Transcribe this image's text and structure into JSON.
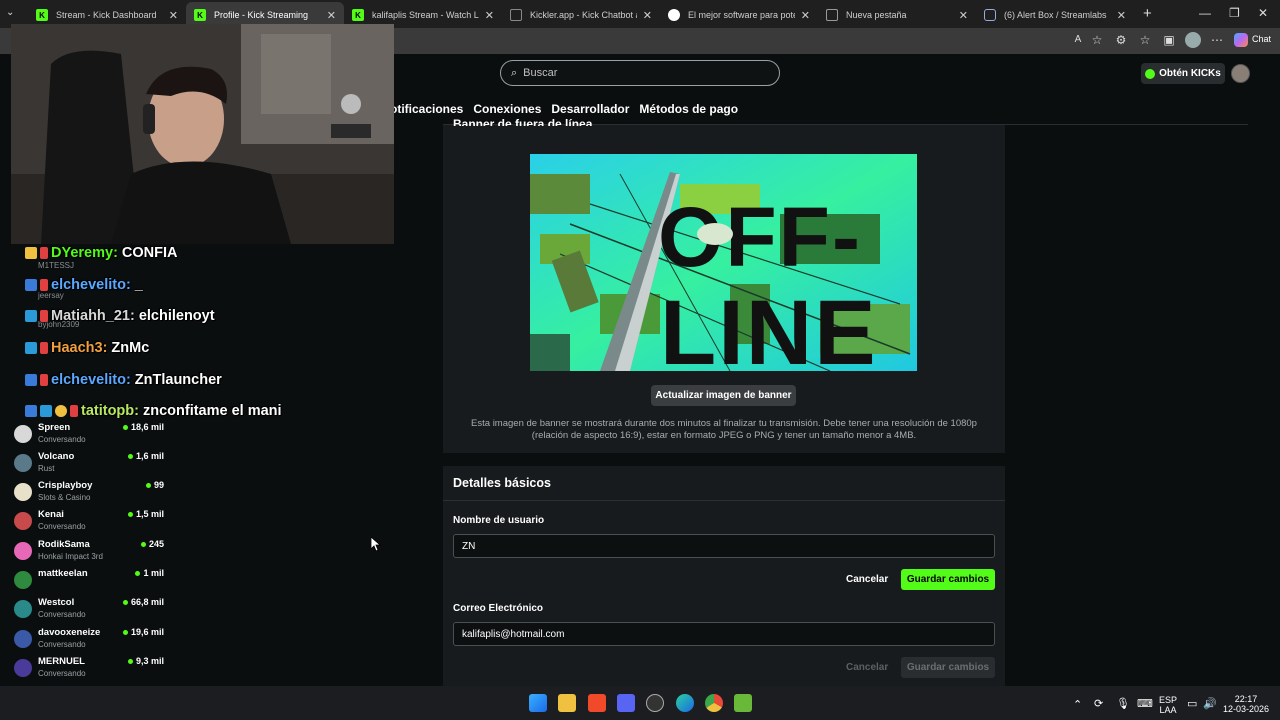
{
  "browser": {
    "tabs": [
      {
        "title": "Stream - Kick Dashboard",
        "active": false
      },
      {
        "title": "Profile - Kick Streaming",
        "active": true
      },
      {
        "title": "kalifaplis Stream - Watch Live on K",
        "active": false
      },
      {
        "title": "Kickler.app - Kick Chatbot and Ov",
        "active": false
      },
      {
        "title": "El mejor software para potenciar t",
        "active": false
      },
      {
        "title": "Nueva pestaña",
        "active": false
      },
      {
        "title": "(6) Alert Box / Streamlabs",
        "active": false
      }
    ],
    "chat_label": "Chat"
  },
  "site": {
    "search_placeholder": "Buscar",
    "get_kicks_label": "Obtén KICKs",
    "settings_nav": [
      "otificaciones",
      "Conexiones",
      "Desarrollador",
      "Métodos de pago"
    ],
    "banner": {
      "heading": "Banner de fuera de línea",
      "image_text_line1": "OFF-",
      "image_text_line2": "LINE",
      "update_button": "Actualizar imagen de banner",
      "description": "Esta imagen de banner se mostrará durante dos minutos al finalizar tu transmisión. Debe tener una resolución de 1080p (relación de aspecto 16:9), estar en formato JPEG o PNG y tener un tamaño menor a 4MB."
    },
    "details": {
      "title": "Detalles básicos",
      "username_label": "Nombre de usuario",
      "username_value": "ZN",
      "email_label": "Correo Electrónico",
      "email_value": "kalifaplis@hotmail.com",
      "cancel_label": "Cancelar",
      "save_label": "Guardar cambios"
    }
  },
  "sidebar": {
    "channels": [
      {
        "name": "Spreen",
        "category": "Conversando",
        "viewers": "18,6 mil",
        "color": "#d8d8d8"
      },
      {
        "name": "Volcano",
        "category": "Rust",
        "viewers": "1,6 mil",
        "color": "#5a7a8a"
      },
      {
        "name": "Crisplayboy",
        "category": "Slots & Casino",
        "viewers": "99",
        "color": "#e8e0c8"
      },
      {
        "name": "Kenai",
        "category": "Conversando",
        "viewers": "1,5 mil",
        "color": "#c84a4a"
      },
      {
        "name": "RodikSama",
        "category": "Honkai Impact 3rd",
        "viewers": "245",
        "color": "#e868b8"
      },
      {
        "name": "mattkeelan",
        "category": "",
        "viewers": "1 mil",
        "color": "#2e8a3e"
      },
      {
        "name": "Westcol",
        "category": "Conversando",
        "viewers": "66,8 mil",
        "color": "#2a8a8a"
      },
      {
        "name": "davooxeneize",
        "category": "Conversando",
        "viewers": "19,6 mil",
        "color": "#3a5aa8"
      },
      {
        "name": "MERNUEL",
        "category": "Conversando",
        "viewers": "9,3 mil",
        "color": "#4a3a9a"
      }
    ]
  },
  "chat_overlay": [
    {
      "user": "DYeremy:",
      "message": "CONFIA",
      "user_color": "#53fc18"
    },
    {
      "user": "elchevelito:",
      "message": "_",
      "user_color": "#5aa8ff"
    },
    {
      "user": "Matiahh_21:",
      "message": "elchilenoyt",
      "user_color": "#d8d8d8"
    },
    {
      "user": "Haach3:",
      "message": "ZnMc",
      "user_color": "#f0a040"
    },
    {
      "user": "elchevelito:",
      "message": "ZnTlauncher",
      "user_color": "#5aa8ff"
    },
    {
      "user": "tatitopb:",
      "message": "znconfitame el mani",
      "user_color": "#b8e860"
    }
  ],
  "chat_faint_names": [
    "M1TESSJ",
    "jeersay",
    "byjohn2309"
  ],
  "taskbar": {
    "language": "ESP",
    "region": "LAA",
    "time": "22:17",
    "date": "12-03-2026"
  }
}
